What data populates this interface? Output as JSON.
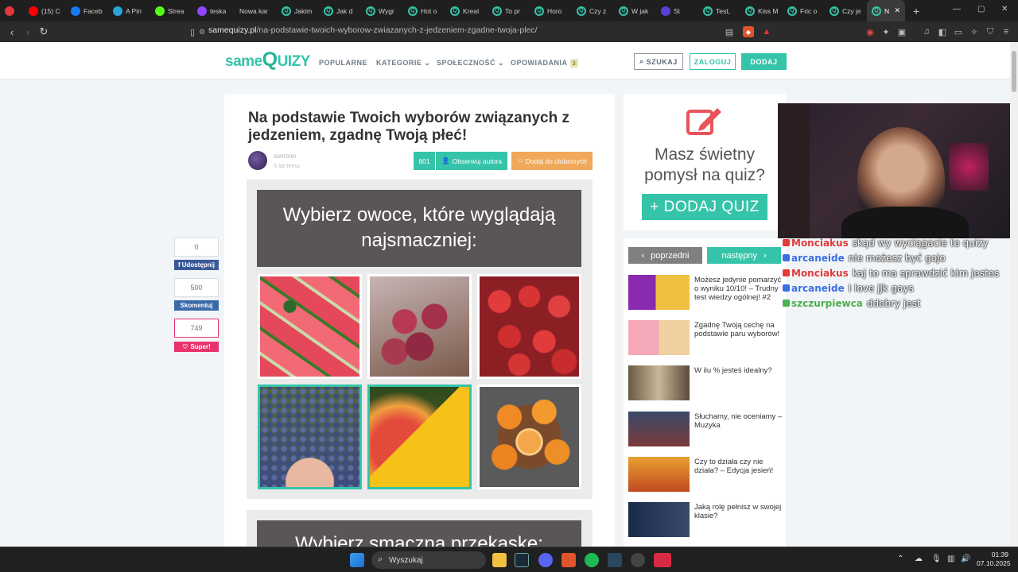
{
  "browser": {
    "tabs": [
      {
        "label": "",
        "icon": "record-icon",
        "color": "#e3363e"
      },
      {
        "label": "(15) C",
        "icon": "youtube-icon",
        "color": "#ff0000"
      },
      {
        "label": "Faceb",
        "icon": "facebook-icon",
        "color": "#1877f2"
      },
      {
        "label": "A Pin",
        "icon": "telegram-icon",
        "color": "#2aa3d8"
      },
      {
        "label": "Strea",
        "icon": "kick-icon",
        "color": "#53fc18"
      },
      {
        "label": "teska",
        "icon": "twitch-icon",
        "color": "#9146ff"
      },
      {
        "label": "Nowa kar",
        "icon": "",
        "color": ""
      },
      {
        "label": "Jakim",
        "icon": "quiz-icon",
        "color": "#35c4a9"
      },
      {
        "label": "Jak d",
        "icon": "quiz-icon",
        "color": "#35c4a9"
      },
      {
        "label": "Wygr",
        "icon": "quiz-icon",
        "color": "#35c4a9"
      },
      {
        "label": "Hot o",
        "icon": "quiz-icon",
        "color": "#35c4a9"
      },
      {
        "label": "Kreat",
        "icon": "quiz-icon",
        "color": "#35c4a9"
      },
      {
        "label": "To pr",
        "icon": "quiz-icon",
        "color": "#35c4a9"
      },
      {
        "label": "Horo",
        "icon": "quiz-icon",
        "color": "#35c4a9"
      },
      {
        "label": "Czy z",
        "icon": "quiz-icon",
        "color": "#35c4a9"
      },
      {
        "label": "W jak",
        "icon": "quiz-icon",
        "color": "#35c4a9"
      },
      {
        "label": "St",
        "icon": "audio-icon",
        "color": "#5a3fd6"
      },
      {
        "label": "Test,",
        "icon": "quiz-icon",
        "color": "#35c4a9"
      },
      {
        "label": "Kiss M",
        "icon": "quiz-icon",
        "color": "#35c4a9"
      },
      {
        "label": "Fric o",
        "icon": "quiz-icon",
        "color": "#35c4a9"
      },
      {
        "label": "Czy je",
        "icon": "quiz-icon",
        "color": "#35c4a9"
      },
      {
        "label": "N",
        "icon": "quiz-icon",
        "color": "#35c4a9",
        "active": true
      }
    ],
    "url_domain": "samequizy.pl",
    "url_path": "/na-podstawie-twoich-wyborow-zwiazanych-z-jedzeniem-zgadne-twoja-plec/"
  },
  "header": {
    "logo_same": "same",
    "logo_q": "Q",
    "logo_uizy": "UIZY",
    "nav": [
      "POPULARNE",
      "KATEGORIE",
      "SPOŁECZNOŚĆ",
      "OPOWIADANIA"
    ],
    "opowiadania_badge": "3",
    "search_label": "SZUKAJ",
    "login_label": "ZALOGUJ",
    "add_label": "DODAJ"
  },
  "quiz": {
    "title": "Na podstawie Twoich wyborów związanych z jedzeniem, zgadnę Twoją płeć!",
    "author": "ssmoon",
    "time": "5 lat temu",
    "count": "801",
    "follow_label": "Obserwuj autora",
    "fav_label": "Dodaj do ulubionych",
    "question1": "Wybierz owoce, które wyglądają najsmaczniej:",
    "question2": "Wybierz smaczną przekąskę:",
    "answers": [
      {
        "name": "watermelon",
        "selected": false
      },
      {
        "name": "plums",
        "selected": false
      },
      {
        "name": "strawberries",
        "selected": false
      },
      {
        "name": "blueberries",
        "selected": true
      },
      {
        "name": "mango",
        "selected": true
      },
      {
        "name": "mandarins",
        "selected": false
      }
    ]
  },
  "share": {
    "share_count": "0",
    "share_label": "Udostępnij",
    "comment_count": "500",
    "comment_label": "Skomentuj",
    "super_count": "749",
    "super_label": "Super!"
  },
  "sidebar": {
    "promo_line1": "Masz świetny",
    "promo_line2": "pomysł na quiz?",
    "promo_button": "+ DODAJ QUIZ",
    "prev_label": "poprzedni",
    "next_label": "następny",
    "related": [
      "Możesz jedynie pomarzyć o wyniku 10/10! – Trudny test wiedzy ogólnej! #2",
      "Zgadnę Twoją cechę na podstawie paru wyborów!",
      "W ilu % jesteś idealny?",
      "Słuchamy, nie oceniamy – Muzyka",
      "Czy to działa czy nie działa? – Edycja jesień!",
      "Jaką rolę pełnisz w swojej klasie?"
    ]
  },
  "chat": [
    {
      "user": "Monciakus",
      "msg": "skąd wy wyciągacie te quizy",
      "color": "#e33a3a"
    },
    {
      "user": "arcaneide",
      "msg": "nie możesz być gojo",
      "color": "#3a6fe3"
    },
    {
      "user": "Monciakus",
      "msg": "kaj to ma sprawdzić kim jestes",
      "color": "#e33a3a"
    },
    {
      "user": "arcaneide",
      "msg": "I love jjk gays",
      "color": "#3a6fe3"
    },
    {
      "user": "szczurpiewca",
      "msg": "ddobry jest",
      "color": "#4caf50"
    }
  ],
  "taskbar": {
    "search_label": "Wyszukaj",
    "time": "01:39",
    "date": "07.10.2025"
  },
  "colors": {
    "accent": "#35c4a9",
    "orange": "#f0a95b",
    "pink": "#e8336c",
    "facebook": "#3b5998"
  }
}
